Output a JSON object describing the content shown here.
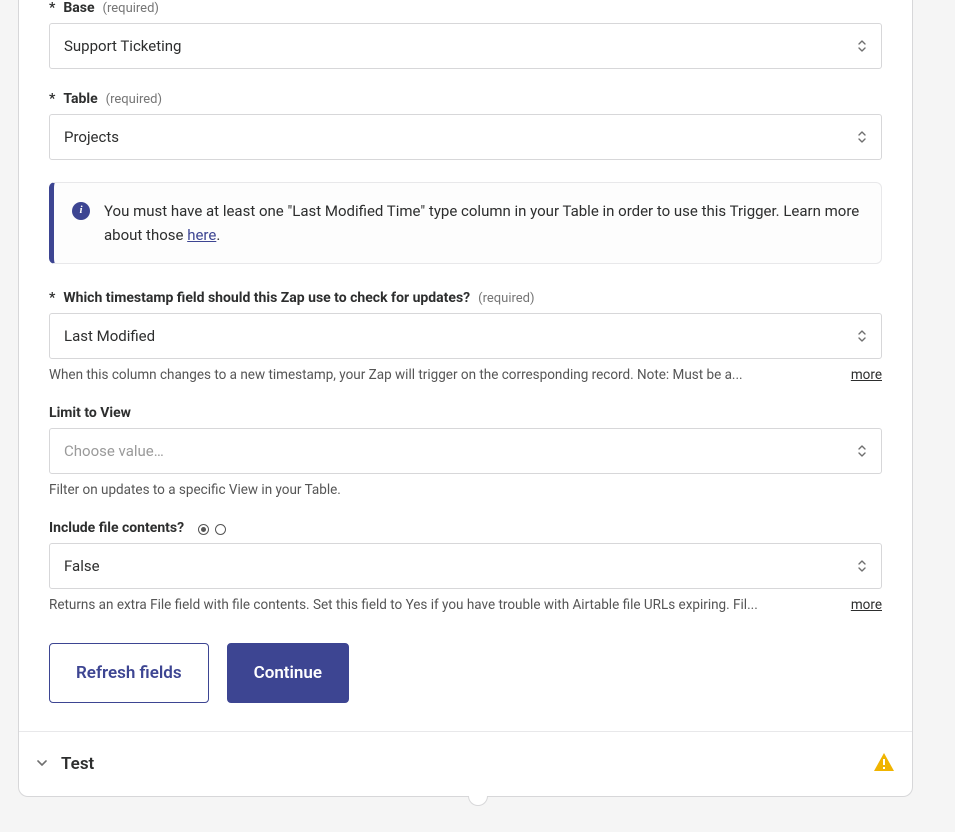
{
  "fields": {
    "base": {
      "label": "Base",
      "required": "(required)",
      "value": "Support Ticketing"
    },
    "table": {
      "label": "Table",
      "required": "(required)",
      "value": "Projects"
    },
    "timestamp": {
      "label": "Which timestamp field should this Zap use to check for updates?",
      "required": "(required)",
      "value": "Last Modified",
      "help": "When this column changes to a new timestamp, your Zap will trigger on the corresponding record. Note: Must be a...",
      "more": "more"
    },
    "limitView": {
      "label": "Limit to View",
      "placeholder": "Choose value…",
      "help": "Filter on updates to a specific View in your Table."
    },
    "includeFiles": {
      "label": "Include file contents?",
      "value": "False",
      "help": "Returns an extra File field with file contents. Set this field to Yes if you have trouble with Airtable file URLs expiring. Fil...",
      "more": "more"
    }
  },
  "info": {
    "text1": "You must have at least one \"Last Modified Time\" type column in your Table in order to use this Trigger. Learn more about those ",
    "link": "here",
    "text2": "."
  },
  "buttons": {
    "refresh": "Refresh fields",
    "continue": "Continue"
  },
  "test": {
    "label": "Test"
  }
}
